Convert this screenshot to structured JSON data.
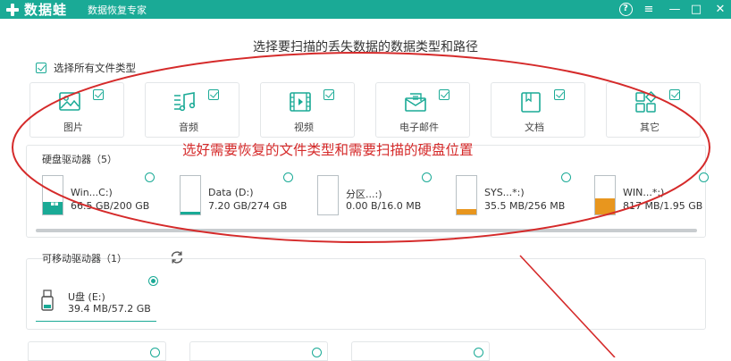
{
  "app": {
    "brand": "数据蛙",
    "subtitle": "数据恢复专家",
    "accent_color": "#1aaa96"
  },
  "window_controls": [
    {
      "name": "help",
      "glyph": "?"
    },
    {
      "name": "menu",
      "glyph": "≡"
    },
    {
      "name": "minimize",
      "glyph": "—"
    },
    {
      "name": "maximize",
      "glyph": "□"
    },
    {
      "name": "close",
      "glyph": "✕"
    }
  ],
  "heading": "选择要扫描的丢失数据的数据类型和路径",
  "select_all": {
    "label": "选择所有文件类型",
    "checked": true
  },
  "file_types": [
    {
      "label": "图片",
      "icon": "image-icon",
      "checked": true
    },
    {
      "label": "音频",
      "icon": "audio-icon",
      "checked": true
    },
    {
      "label": "视频",
      "icon": "video-icon",
      "checked": true
    },
    {
      "label": "电子邮件",
      "icon": "email-icon",
      "checked": true
    },
    {
      "label": "文档",
      "icon": "document-icon",
      "checked": true
    },
    {
      "label": "其它",
      "icon": "other-icon",
      "checked": true
    }
  ],
  "hard_drives": {
    "title": "硬盘驱动器（5）",
    "drives": [
      {
        "name": "Win...C:)",
        "size": "66.5 GB/200 GB",
        "fill": 0.33,
        "fill_color": "#1aaa96",
        "system": true
      },
      {
        "name": "Data (D:)",
        "size": "7.20 GB/274 GB",
        "fill": 0.03,
        "fill_color": "#1aaa96",
        "system": false
      },
      {
        "name": "分区...:)",
        "size": "0.00  B/16.0 MB",
        "fill": 0.0,
        "fill_color": "#e8961e",
        "system": false
      },
      {
        "name": "SYS...*:)",
        "size": "35.5 MB/256 MB",
        "fill": 0.14,
        "fill_color": "#e8961e",
        "system": false
      },
      {
        "name": "WIN...*:)",
        "size": "817 MB/1.95 GB",
        "fill": 0.42,
        "fill_color": "#e8961e",
        "system": false
      }
    ]
  },
  "removable_drives": {
    "title": "可移动驱动器（1）",
    "drives": [
      {
        "name": "U盘 (E:)",
        "size": "39.4 MB/57.2 GB",
        "selected": true
      }
    ]
  },
  "annotation": {
    "text": "选好需要恢复的文件类型和需要扫描的硬盘位置",
    "color": "#d52a2a"
  }
}
